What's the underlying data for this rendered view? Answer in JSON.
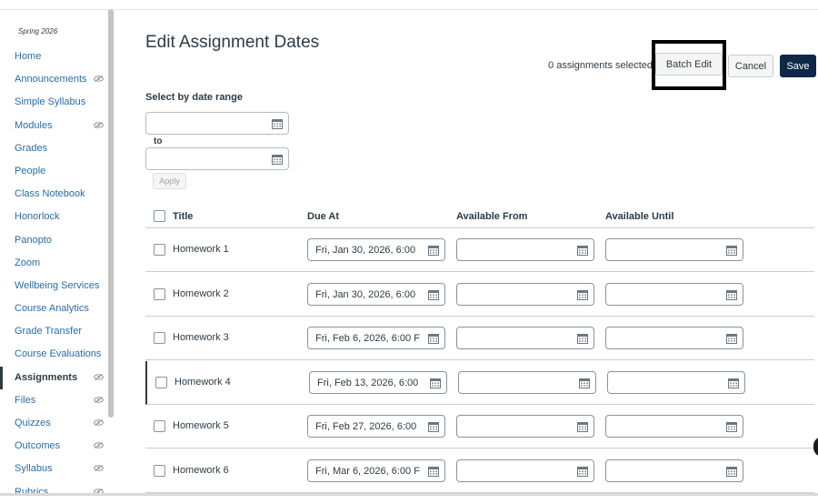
{
  "sidebar": {
    "term": "Spring 2026",
    "items": [
      {
        "label": "Home",
        "hidden": false,
        "active": false
      },
      {
        "label": "Announcements",
        "hidden": true,
        "active": false
      },
      {
        "label": "Simple Syllabus",
        "hidden": false,
        "active": false
      },
      {
        "label": "Modules",
        "hidden": true,
        "active": false
      },
      {
        "label": "Grades",
        "hidden": false,
        "active": false
      },
      {
        "label": "People",
        "hidden": false,
        "active": false
      },
      {
        "label": "Class Notebook",
        "hidden": false,
        "active": false
      },
      {
        "label": "Honorlock",
        "hidden": false,
        "active": false
      },
      {
        "label": "Panopto",
        "hidden": false,
        "active": false
      },
      {
        "label": "Zoom",
        "hidden": false,
        "active": false
      },
      {
        "label": "Wellbeing Services",
        "hidden": false,
        "active": false
      },
      {
        "label": "Course Analytics",
        "hidden": false,
        "active": false
      },
      {
        "label": "Grade Transfer",
        "hidden": false,
        "active": false
      },
      {
        "label": "Course Evaluations",
        "hidden": false,
        "active": false
      },
      {
        "label": "Assignments",
        "hidden": true,
        "active": true
      },
      {
        "label": "Files",
        "hidden": true,
        "active": false
      },
      {
        "label": "Quizzes",
        "hidden": true,
        "active": false
      },
      {
        "label": "Outcomes",
        "hidden": true,
        "active": false
      },
      {
        "label": "Syllabus",
        "hidden": true,
        "active": false
      },
      {
        "label": "Rubrics",
        "hidden": true,
        "active": false
      }
    ]
  },
  "header": {
    "title": "Edit Assignment Dates",
    "selected_count": "0 assignments selected",
    "batch_edit_label": "Batch Edit",
    "cancel_label": "Cancel",
    "save_label": "Save"
  },
  "range": {
    "label": "Select by date range",
    "start_value": "",
    "to_label": "to",
    "end_value": "",
    "apply_label": "Apply"
  },
  "table": {
    "columns": {
      "title": "Title",
      "due": "Due At",
      "from": "Available From",
      "until": "Available Until"
    },
    "rows": [
      {
        "title": "Homework 1",
        "due": "Fri, Jan 30, 2026, 6:00",
        "from": "",
        "until": ""
      },
      {
        "title": "Homework 2",
        "due": "Fri, Jan 30, 2026, 6:00",
        "from": "",
        "until": ""
      },
      {
        "title": "Homework 3",
        "due": "Fri, Feb 6, 2026, 6:00 F",
        "from": "",
        "until": ""
      },
      {
        "title": "Homework 4",
        "due": "Fri, Feb 13, 2026, 6:00",
        "from": "",
        "until": ""
      },
      {
        "title": "Homework 5",
        "due": "Fri, Feb 27, 2026, 6:00",
        "from": "",
        "until": ""
      },
      {
        "title": "Homework 6",
        "due": "Fri, Mar 6, 2026, 6:00 F",
        "from": "",
        "until": ""
      }
    ]
  },
  "icons": {
    "calendar": "calendar-icon",
    "hidden": "eye-slash-icon"
  },
  "colors": {
    "link": "#2b6ca3",
    "text": "#2d3b45",
    "save": "#0e2847",
    "border": "#c7cdd1"
  }
}
